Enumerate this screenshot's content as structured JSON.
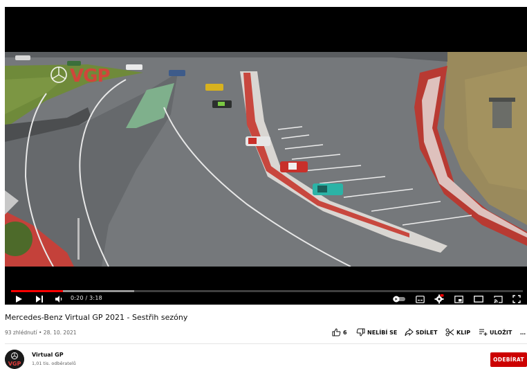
{
  "player": {
    "time_display": "0:20 / 3:18",
    "progress_fraction": 0.101,
    "buffered_fraction": 0.24,
    "watermark_text": "VGP"
  },
  "video": {
    "title": "Mercedes-Benz Virtual GP 2021 - Sestřih sezóny",
    "meta": "93 zhlédnutí • 28. 10. 2021"
  },
  "actions": {
    "like_count": "6",
    "dislike_label": "NELÍBÍ SE",
    "share_label": "SDÍLET",
    "clip_label": "KLIP",
    "save_label": "ULOŽIT",
    "more_label": "…"
  },
  "channel": {
    "name": "Virtual GP",
    "subscribers": "1,01 tis. odběratelů",
    "subscribe_label": "ODEBÍRAT"
  },
  "colors": {
    "accent_red": "#ff0000",
    "subscribe_red": "#cc0000",
    "player_bg": "#000000"
  },
  "icons": [
    "play-icon",
    "next-icon",
    "volume-icon",
    "autoplay-toggle-icon",
    "subtitles-icon",
    "settings-icon",
    "miniplayer-icon",
    "theater-icon",
    "cast-icon",
    "fullscreen-icon",
    "like-icon",
    "dislike-icon",
    "share-icon",
    "clip-icon",
    "save-icon",
    "more-icon"
  ]
}
